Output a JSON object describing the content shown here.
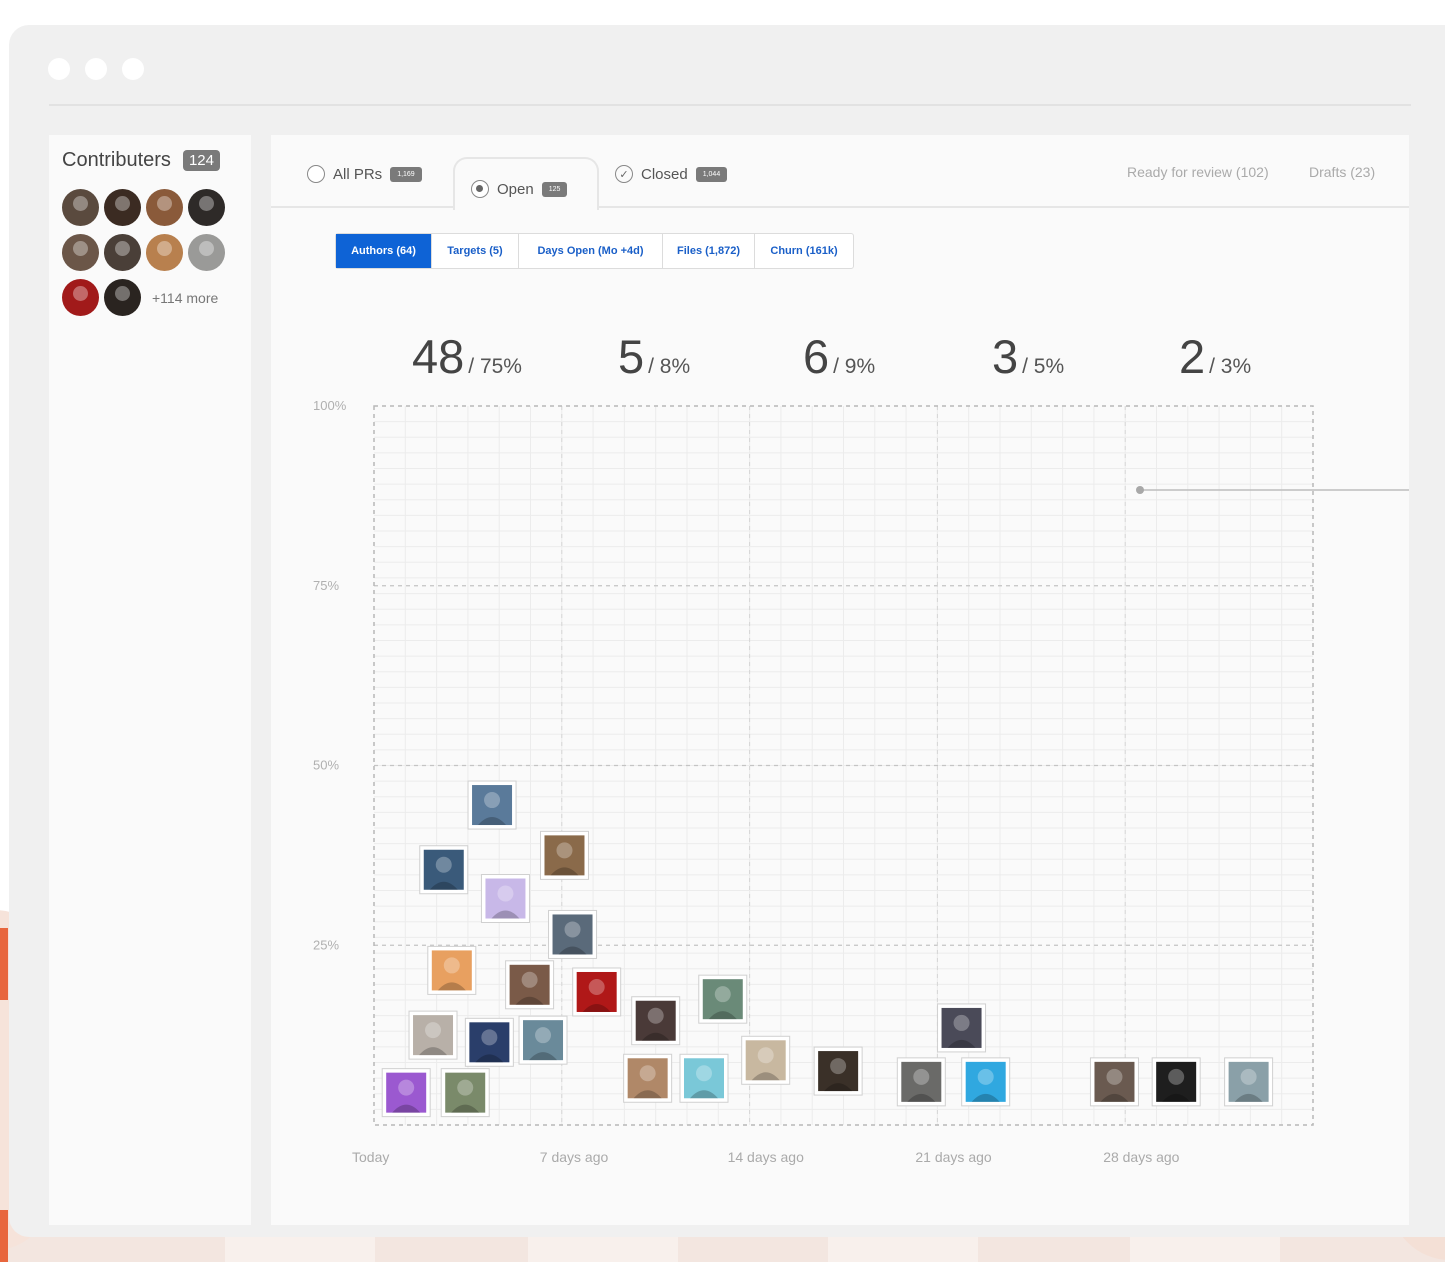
{
  "sidebar": {
    "title": "Contributers",
    "count": "124",
    "more": "+114 more",
    "avatars": [
      "#5a4a3e",
      "#3b2b22",
      "#8a5a3a",
      "#2e2a28",
      "#6b5648",
      "#4a3f38",
      "#b8804e",
      "#9a9a98",
      "#a11a1a",
      "#2a2420"
    ]
  },
  "tabs": {
    "all": {
      "label": "All PRs",
      "badge": "1,169"
    },
    "open": {
      "label": "Open",
      "badge": "125"
    },
    "closed": {
      "label": "Closed",
      "badge": "1,044"
    },
    "ready": "Ready for review (102)",
    "drafts": "Drafts (23)"
  },
  "filters": [
    "Authors (64)",
    "Targets (5)",
    "Days Open (Mo +4d)",
    "Files (1,872)",
    "Churn (161k)"
  ],
  "stats": [
    {
      "count": "48",
      "pct": "/ 75%"
    },
    {
      "count": "5",
      "pct": "/ 8%"
    },
    {
      "count": "6",
      "pct": "/ 9%"
    },
    {
      "count": "3",
      "pct": "/ 5%"
    },
    {
      "count": "2",
      "pct": "/ 3%"
    }
  ],
  "chart_data": {
    "type": "scatter",
    "y_ticks": [
      "100%",
      "75%",
      "50%",
      "25%"
    ],
    "x_ticks": [
      "Today",
      "7 days ago",
      "14 days ago",
      "21 days ago",
      "28 days ago"
    ],
    "xlim": [
      0,
      35
    ],
    "ylim": [
      0,
      100
    ],
    "points": [
      {
        "x": 1.2,
        "y": 4.5,
        "color": "#9b59d0"
      },
      {
        "x": 3.4,
        "y": 4.5,
        "color": "#7a8a6a"
      },
      {
        "x": 2.2,
        "y": 12.5,
        "color": "#b8b0a8"
      },
      {
        "x": 4.3,
        "y": 11.5,
        "color": "#2a3e6a"
      },
      {
        "x": 6.3,
        "y": 11.8,
        "color": "#6a8a9a"
      },
      {
        "x": 2.9,
        "y": 21.5,
        "color": "#e8a060"
      },
      {
        "x": 5.8,
        "y": 19.5,
        "color": "#7a5a48"
      },
      {
        "x": 8.3,
        "y": 18.5,
        "color": "#b01818"
      },
      {
        "x": 7.4,
        "y": 26.5,
        "color": "#5a6a7a"
      },
      {
        "x": 4.9,
        "y": 31.5,
        "color": "#c8b8e8"
      },
      {
        "x": 2.6,
        "y": 35.5,
        "color": "#3a5a7a"
      },
      {
        "x": 7.1,
        "y": 37.5,
        "color": "#8a6a4a"
      },
      {
        "x": 4.4,
        "y": 44.5,
        "color": "#5a7a9a"
      },
      {
        "x": 10.5,
        "y": 14.5,
        "color": "#4a3a38"
      },
      {
        "x": 10.2,
        "y": 6.5,
        "color": "#b08868"
      },
      {
        "x": 12.3,
        "y": 6.5,
        "color": "#7ac8d8"
      },
      {
        "x": 13.0,
        "y": 17.5,
        "color": "#6a8a78"
      },
      {
        "x": 14.6,
        "y": 9.0,
        "color": "#c8b8a0"
      },
      {
        "x": 17.3,
        "y": 7.5,
        "color": "#3a3028"
      },
      {
        "x": 20.4,
        "y": 6.0,
        "color": "#6a6a68"
      },
      {
        "x": 22.8,
        "y": 6.0,
        "color": "#30a8e0"
      },
      {
        "x": 21.9,
        "y": 13.5,
        "color": "#4a4a58"
      },
      {
        "x": 27.6,
        "y": 6.0,
        "color": "#6a5a50"
      },
      {
        "x": 29.9,
        "y": 6.0,
        "color": "#1e1e1e"
      },
      {
        "x": 32.6,
        "y": 6.0,
        "color": "#8aa0a8"
      }
    ]
  }
}
